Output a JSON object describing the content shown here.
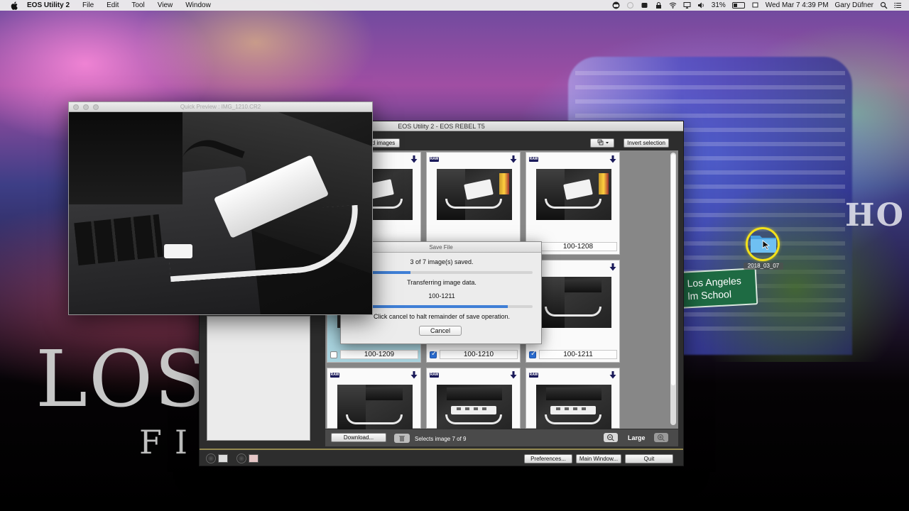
{
  "menubar": {
    "app_name": "EOS Utility 2",
    "menus": [
      "File",
      "Edit",
      "Tool",
      "View",
      "Window"
    ],
    "battery": "31%",
    "datetime": "Wed Mar 7  4:39 PM",
    "user": "Gary Düfner"
  },
  "desktop": {
    "folder_label": "2018_03_07",
    "street_sign_line1": "Los Angeles",
    "street_sign_line2": "lm School",
    "big_text": "LOS",
    "big_text_sub": "FI",
    "hood_text": "HO"
  },
  "eos_window": {
    "title": "EOS Utility 2 - EOS REBEL T5",
    "partial_button": "d images",
    "invert_selection": "Invert selection",
    "thumbnails": [
      {
        "name": "",
        "raw": false,
        "checked": false,
        "selected": false,
        "scene": "cable"
      },
      {
        "name": "",
        "raw": true,
        "checked": false,
        "selected": false,
        "scene": "device"
      },
      {
        "name": "100-1208",
        "raw": true,
        "checked": false,
        "selected": false,
        "scene": "device"
      },
      {
        "name": "100-1209",
        "raw": false,
        "checked": false,
        "selected": true,
        "scene": "cable"
      },
      {
        "name": "100-1210",
        "raw": false,
        "checked": true,
        "selected": false,
        "scene": "cable"
      },
      {
        "name": "100-1211",
        "raw": false,
        "checked": true,
        "selected": false,
        "scene": "laptop"
      },
      {
        "name": "",
        "raw": true,
        "checked": false,
        "selected": false,
        "scene": "laptop"
      },
      {
        "name": "",
        "raw": true,
        "checked": false,
        "selected": false,
        "scene": "hub"
      },
      {
        "name": "",
        "raw": true,
        "checked": false,
        "selected": false,
        "scene": "hub"
      }
    ],
    "raw_badge": "RAW",
    "download_label": "Download...",
    "status": "Selects image 7 of 9",
    "size_label": "Large",
    "preferences_label": "Preferences...",
    "main_window_label": "Main Window...",
    "quit_label": "Quit"
  },
  "save_dialog": {
    "title": "Save File",
    "saved_text": "3 of 7 image(s) saved.",
    "overall_progress": 0.31,
    "transfer_text": "Transferring image data.",
    "current_file": "100-1211",
    "file_progress": 0.86,
    "hint": "Click cancel to halt remainder of save operation.",
    "cancel_label": "Cancel"
  },
  "preview": {
    "title": "Quick Preview : IMG_1210.CR2"
  },
  "colors": {
    "selection": "#a9d4df",
    "progress": "#3f7fd6",
    "highlight_ring": "#f3e11a"
  }
}
